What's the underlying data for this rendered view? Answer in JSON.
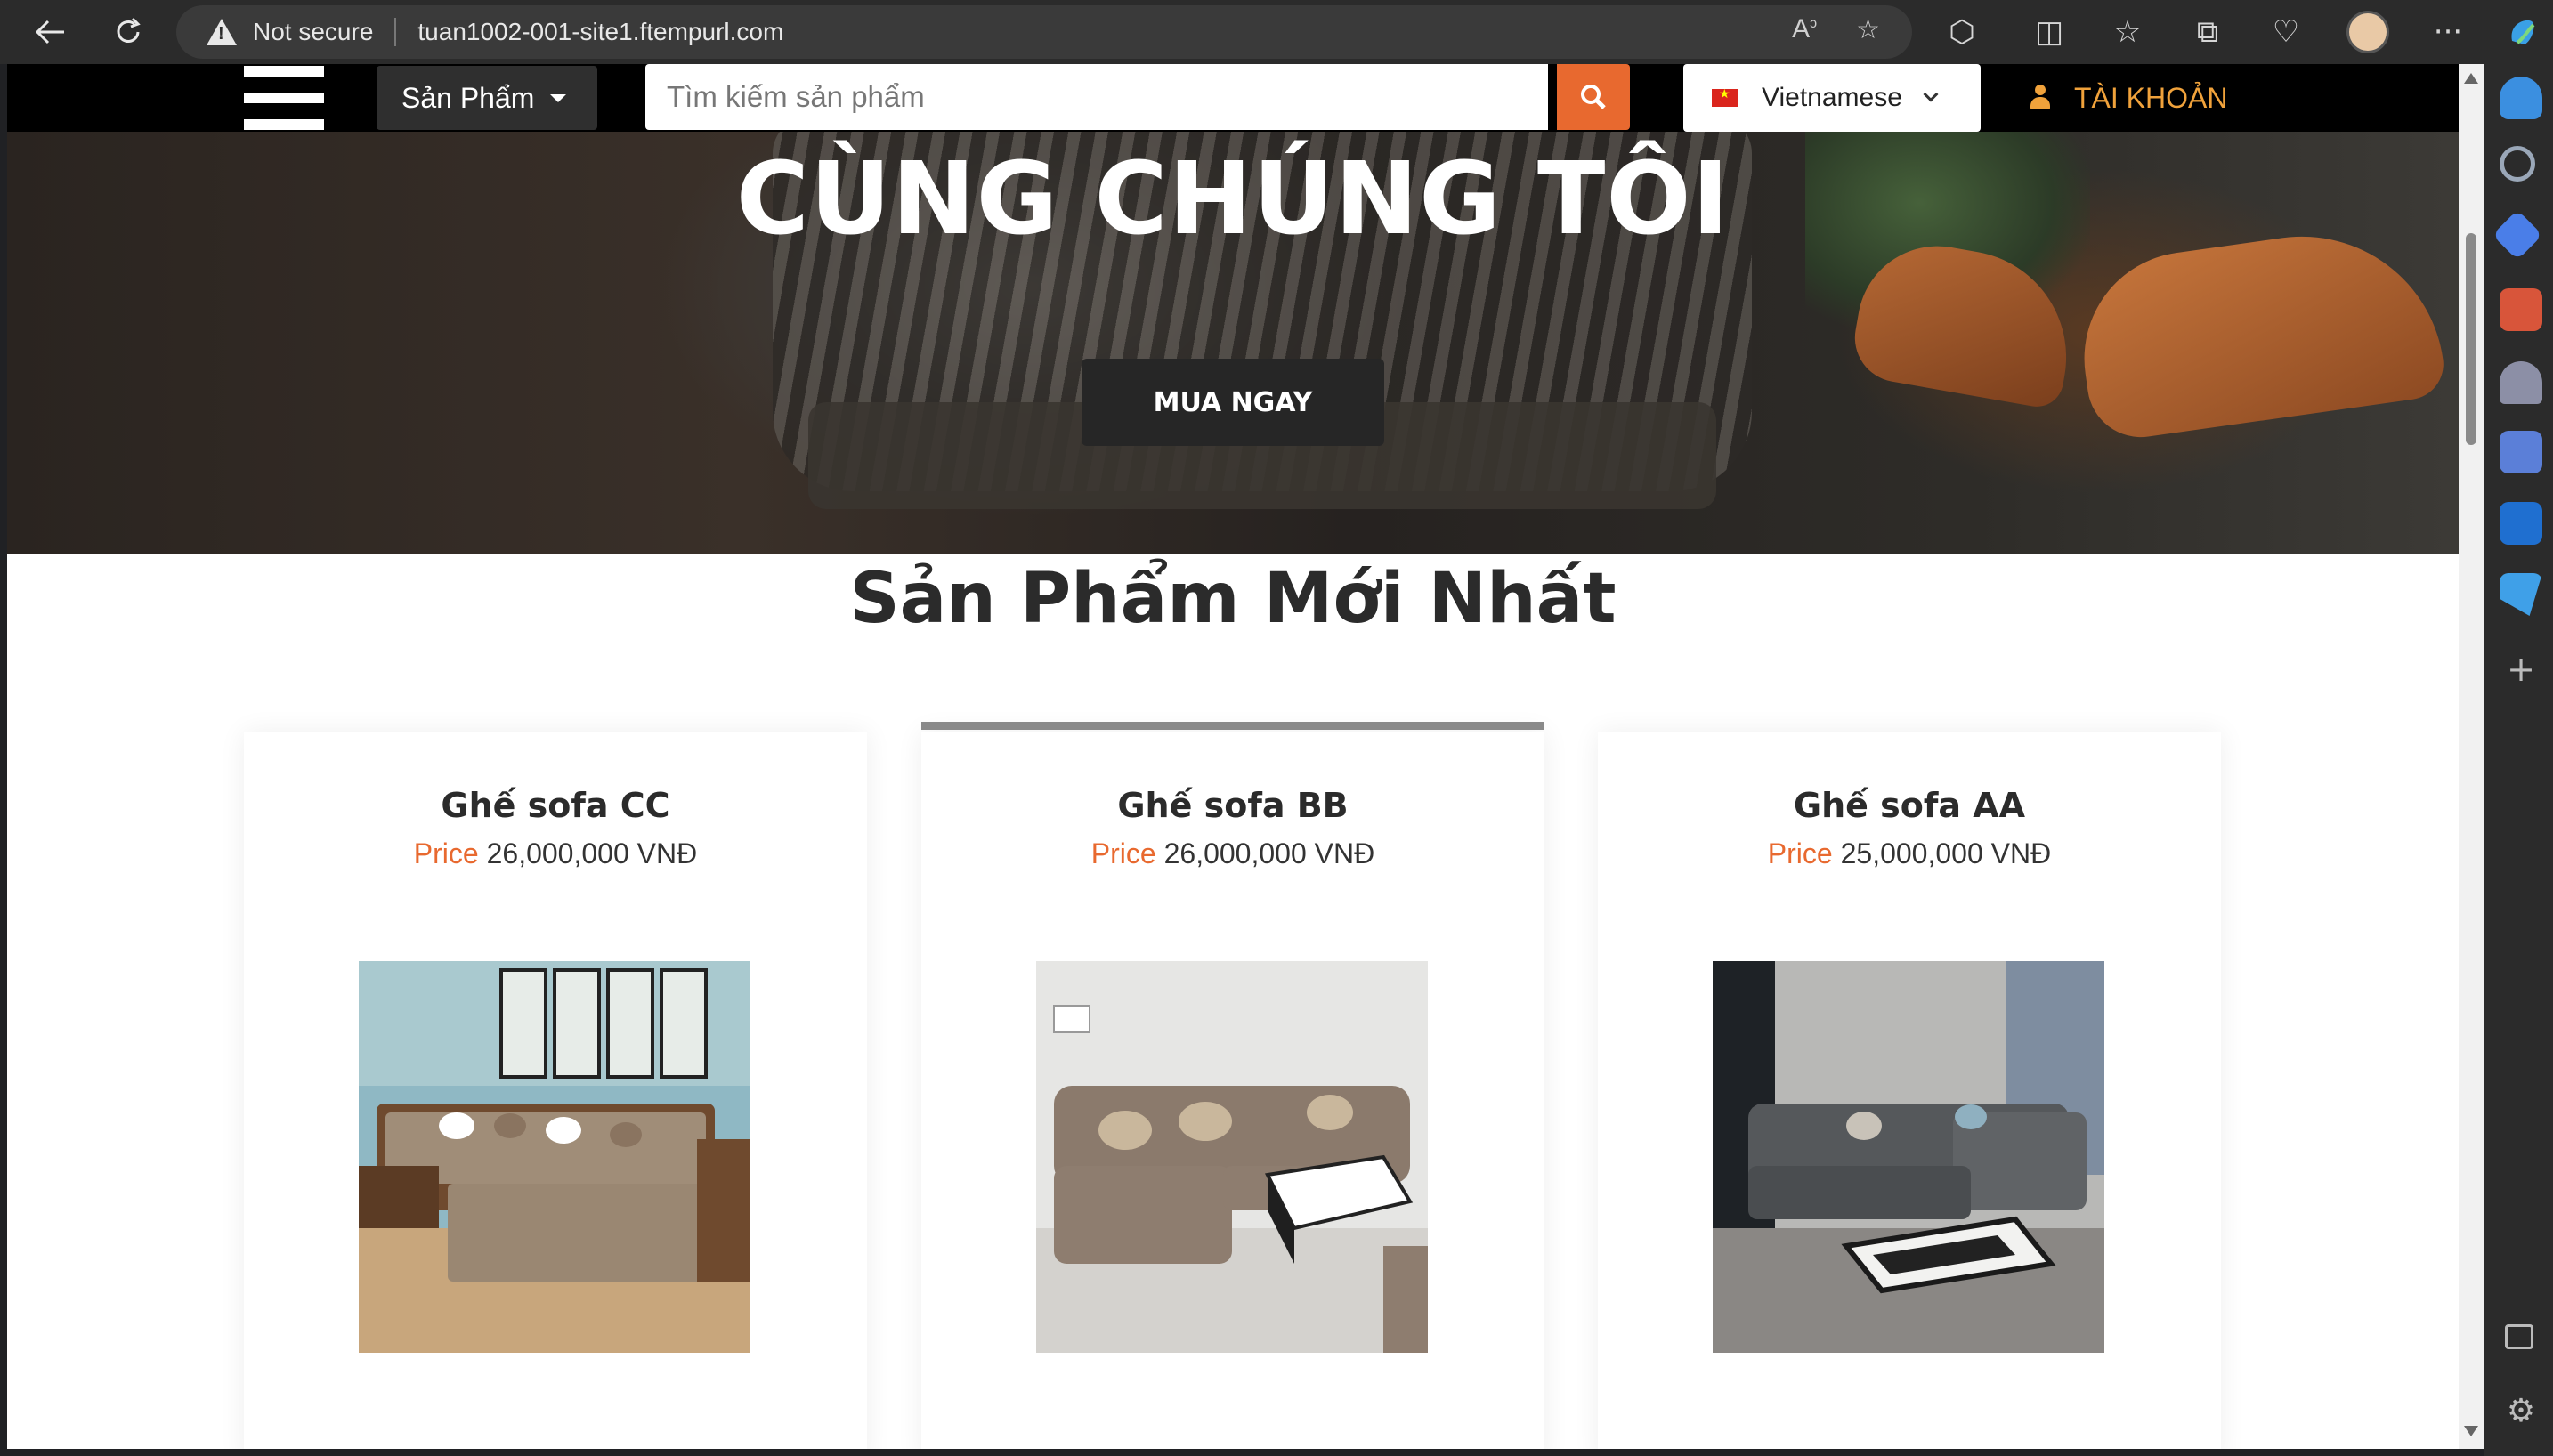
{
  "browser": {
    "security_label": "Not secure",
    "url": "tuan1002-001-site1.ftempurl.com"
  },
  "header": {
    "category_label": "Sản Phẩm",
    "search_placeholder": "Tìm kiếm sản phẩm",
    "language": "Vietnamese",
    "account_label": "TÀI KHOẢN",
    "accent_color": "#e8692f"
  },
  "hero": {
    "title": "CÙNG CHÚNG TÔI",
    "cta_label": "MUA NGAY"
  },
  "products_section": {
    "title": "Sản Phẩm Mới Nhất",
    "price_label": "Price",
    "items": [
      {
        "name": "Ghế sofa CC",
        "price": "26,000,000 VNĐ",
        "image_icon": "wooden-sofa-image"
      },
      {
        "name": "Ghế sofa BB",
        "price": "26,000,000 VNĐ",
        "image_icon": "beige-sofa-image"
      },
      {
        "name": "Ghế sofa AA",
        "price": "25,000,000 VNĐ",
        "image_icon": "gray-leather-sofa-image"
      }
    ]
  }
}
